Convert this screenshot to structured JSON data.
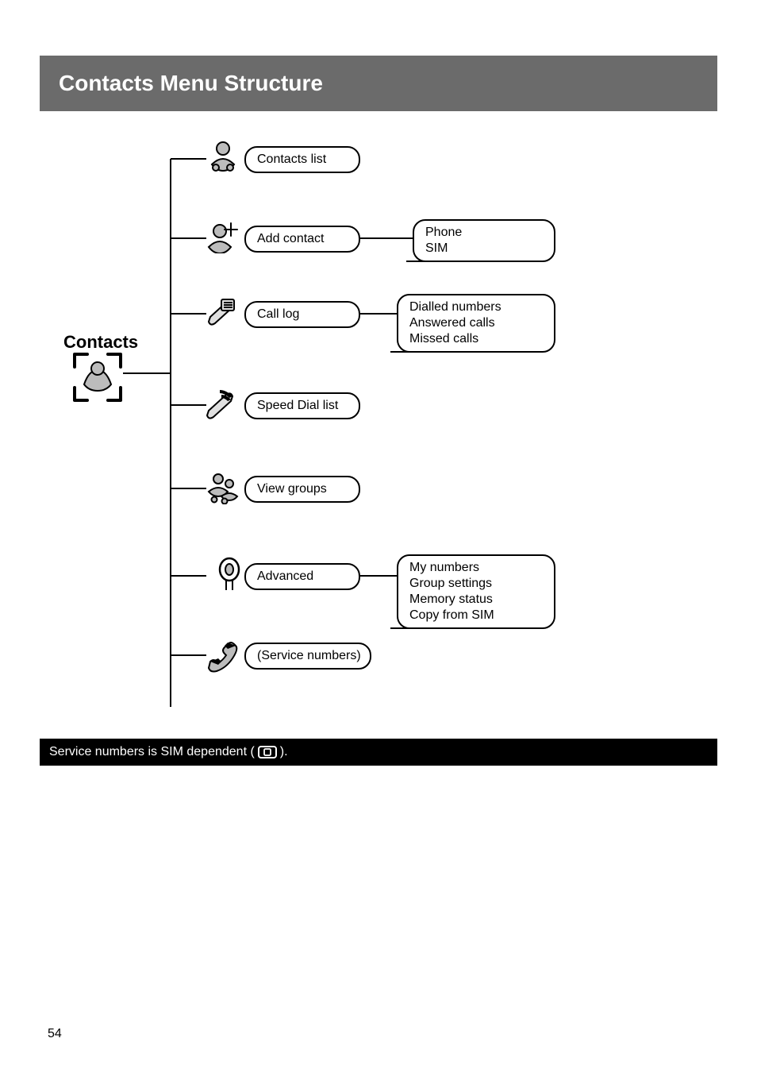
{
  "title": "Contacts Menu Structure",
  "root": {
    "label": "Contacts"
  },
  "nodes": {
    "contacts_list": {
      "label": "Contacts list"
    },
    "add_contact": {
      "label": "Add contact"
    },
    "call_log": {
      "label": "Call log"
    },
    "speed_dial": {
      "label": "Speed Dial list"
    },
    "view_groups": {
      "label": "View groups"
    },
    "advanced": {
      "label": "Advanced"
    },
    "service_nums": {
      "label": "(Service numbers)"
    },
    "add_contact_sub": {
      "lines": [
        "Phone",
        "SIM"
      ]
    },
    "call_log_sub": {
      "lines": [
        "Dialled numbers",
        "Answered calls",
        "Missed calls"
      ]
    },
    "advanced_sub": {
      "lines": [
        "My numbers",
        "Group settings",
        "Memory status",
        "Copy from SIM"
      ]
    }
  },
  "footnote": {
    "before": "Service numbers is SIM dependent (",
    "after": ")."
  },
  "page_number": "54"
}
